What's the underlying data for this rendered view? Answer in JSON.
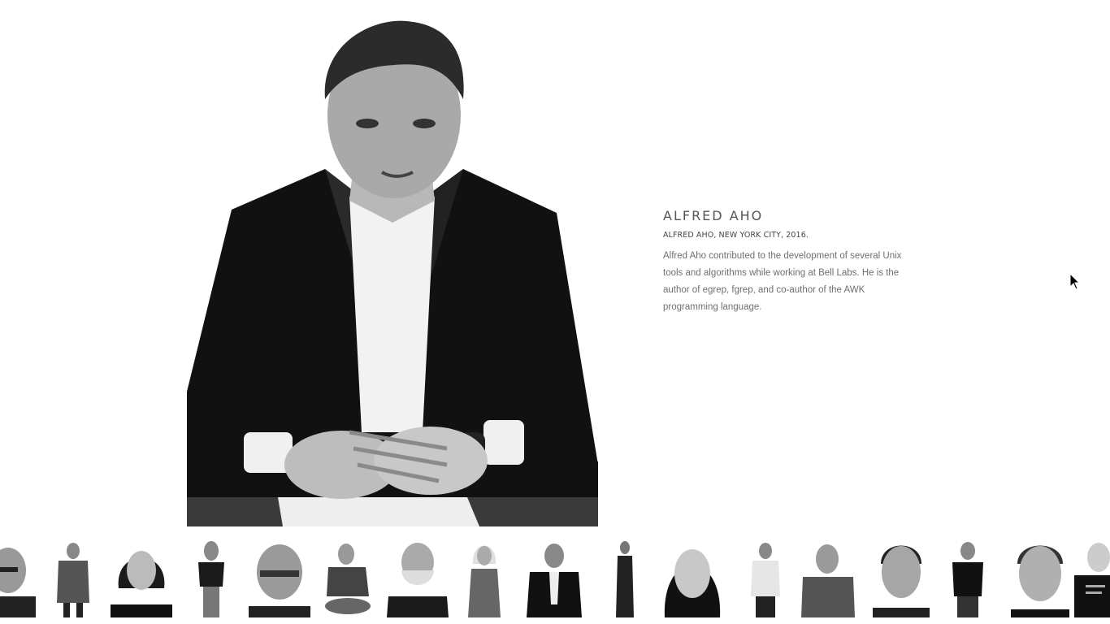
{
  "person": {
    "name": "ALFRED AHO",
    "caption": "ALFRED AHO, NEW YORK CITY, 2016.",
    "description": "Alfred Aho contributed to the development of several Unix tools and algorithms while working at Bell Labs. He is the author of egrep, fgrep, and co-author of the AWK programming language."
  },
  "thumbnail_strip": {
    "count": 17
  },
  "colors": {
    "background": "#ffffff",
    "text_dark": "#555555",
    "text_body": "#6f6f6f"
  }
}
